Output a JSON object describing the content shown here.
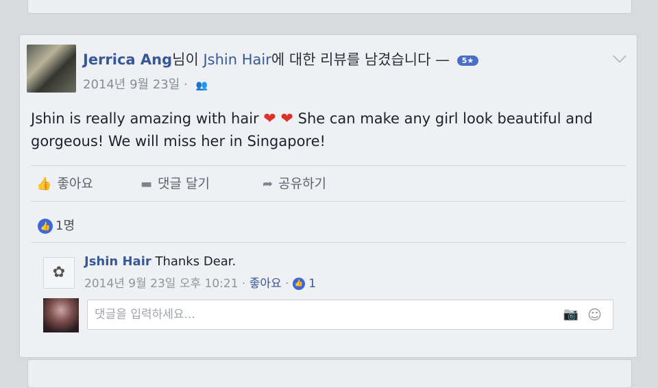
{
  "post": {
    "author": "Jerrica Ang",
    "header_text_1": "님이 ",
    "page_name": "Jshin Hair",
    "header_text_2": "에 대한 리뷰를 남겼습니다 — ",
    "rating_badge": "5★",
    "date": "2014년 9월 23일 ·",
    "body_text_1": "Jshin is really amazing with hair ",
    "body_text_2": " She can make any girl look beautiful and gorgeous! We will miss her in Singapore!"
  },
  "actions": {
    "like": "좋아요",
    "comment": "댓글 달기",
    "share": "공유하기"
  },
  "reactions": {
    "count": "1명"
  },
  "comment": {
    "author": "Jshin Hair",
    "text": "Thanks Dear.",
    "timestamp": "2014년 9월 23일 오후 10:21 ·",
    "like_label": "좋아요",
    "separator": " ·",
    "like_count": "1"
  },
  "comment_input": {
    "placeholder": "댓글을 입력하세요..."
  },
  "icons": {
    "like": "thumbs-up-icon",
    "comment": "speech-bubble-icon",
    "share": "share-arrow-icon",
    "audience": "friends-icon",
    "camera": "camera-icon",
    "emoji": "smile-icon"
  },
  "colors": {
    "link": "#365899",
    "like_blue": "#3b67d8",
    "heart": "#e0302a"
  }
}
